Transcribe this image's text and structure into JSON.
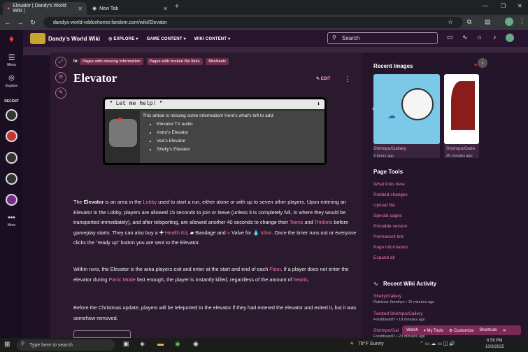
{
  "browser": {
    "tabs": [
      {
        "title": "Elevator | Dandy's World Wiki |"
      },
      {
        "title": "New Tab"
      }
    ],
    "url": "dandys-world-robloxhorror.fandom.com/wiki/Elevator"
  },
  "wiki": {
    "name": "Dandy's World Wiki",
    "nav": [
      "EXPLORE",
      "GAME CONTENT",
      "WIKI CONTENT"
    ],
    "search_placeholder": "Search"
  },
  "rail": {
    "menu": "Menu",
    "explore": "Explore",
    "recent": "RECENT",
    "more": "More"
  },
  "article": {
    "in_label": "In:",
    "categories": [
      "Pages with missing information",
      "Pages with broken file links",
      "Mechanic"
    ],
    "title": "Elevator",
    "edit": "EDIT",
    "notice": {
      "header": "\" Let me help! \"",
      "arrow": "⬇",
      "intro": "This article is missing some information! Here's what's left to add:",
      "items": [
        "Elevator TV audio",
        "Astro's Elevator",
        "Vee's Elevator",
        "Shelly's Elevator"
      ]
    },
    "p1": {
      "a": "The ",
      "b": "Elevator",
      "c": " is an area in the ",
      "d": "Lobby",
      "e": " used to start a run, either alone or with up to seven other players. Upon entering an Elevator in the Lobby, players are allowed 15 seconds to join or leave (unless it is completely full, in where they would be transported immediately), and after teleporting, are allowed another 40 seconds to change their ",
      "f": "Toons",
      "g": " and ",
      "h": "Trinkets",
      "i": " before gameplay starts. They can also buy a ",
      "j": "Health Kit",
      "k": ", ",
      "l": "Bandage and ",
      "m": "Valve for ",
      "n": "Ichor",
      "o": ". Once the timer runs out or everyone clicks the \"ready up\" button you are sent to the Elevator."
    },
    "p2": {
      "a": "Within runs, the Elevator is the area players exit and enter at the start and end of each ",
      "b": "Floor",
      "c": ". If a player does not enter the elevator during ",
      "d": "Panic Mode",
      "e": " fast enough, the player is instantly killed, regardless of the amount of ",
      "f": "hearts",
      "g": "."
    },
    "p3": "Before the Christmas update, players will be teleported to the elevator if they had entered the elevator and exited it, but it was somehow removed."
  },
  "right": {
    "recent_images": "Recent Images",
    "images": [
      {
        "name": "Shrimpo/Gallery",
        "time": "2 hours ago"
      },
      {
        "name": "Shrimpo/Galle",
        "time": "25 minutes ago"
      }
    ],
    "page_tools": "Page Tools",
    "tools": [
      "What links here",
      "Related changes",
      "Upload file",
      "Special pages",
      "Printable version",
      "Permanent link",
      "Page information",
      "Expand all"
    ],
    "activity_title": "Recent Wiki Activity",
    "activity": [
      {
        "page": "Shelly/Gallery",
        "meta": "Rainbow Jimothys • 16 minutes ago"
      },
      {
        "page": "Twisted Shrimpo/Gallery",
        "meta": "Freshbear87 • 19 minutes ago"
      },
      {
        "page": "Shrimpo/Gal",
        "meta": "Freshbear87 • 23 minutes ago"
      }
    ]
  },
  "toolbar": {
    "watch": "Watch",
    "mytools": "▾ My Tools",
    "customize": "⚙ Customize",
    "shortcuts": "Shortcuts"
  },
  "taskbar": {
    "search": "Type here to search",
    "weather": "79°F  Sunny",
    "time": "6:58 PM",
    "date": "10/3/2025"
  }
}
